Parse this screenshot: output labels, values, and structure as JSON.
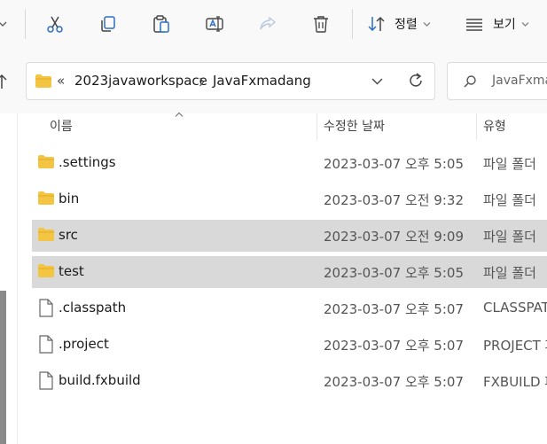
{
  "toolbar": {
    "sort_label": "정렬",
    "view_label": "보기"
  },
  "address": {
    "overflow": "«",
    "crumbs": [
      "2023javaworkspace",
      "JavaFxmadang"
    ]
  },
  "search": {
    "placeholder": "JavaFxma"
  },
  "columns": {
    "name": "이름",
    "date": "수정한 날짜",
    "type": "유형"
  },
  "files": [
    {
      "name": ".settings",
      "date": "2023-03-07 오후 5:05",
      "type": "파일 폴더",
      "kind": "folder",
      "selected": false
    },
    {
      "name": "bin",
      "date": "2023-03-07 오전 9:32",
      "type": "파일 폴더",
      "kind": "folder",
      "selected": false
    },
    {
      "name": "src",
      "date": "2023-03-07 오전 9:09",
      "type": "파일 폴더",
      "kind": "folder",
      "selected": true
    },
    {
      "name": "test",
      "date": "2023-03-07 오후 5:05",
      "type": "파일 폴더",
      "kind": "folder",
      "selected": true
    },
    {
      "name": ".classpath",
      "date": "2023-03-07 오후 5:07",
      "type": "CLASSPATH",
      "kind": "file",
      "selected": false
    },
    {
      "name": ".project",
      "date": "2023-03-07 오후 5:07",
      "type": "PROJECT 파",
      "kind": "file",
      "selected": false
    },
    {
      "name": "build.fxbuild",
      "date": "2023-03-07 오후 5:07",
      "type": "FXBUILD 파",
      "kind": "file",
      "selected": false
    }
  ],
  "colors": {
    "folder": "#f4c542",
    "selection": "#d9d9d9",
    "accent": "#0067c0"
  }
}
